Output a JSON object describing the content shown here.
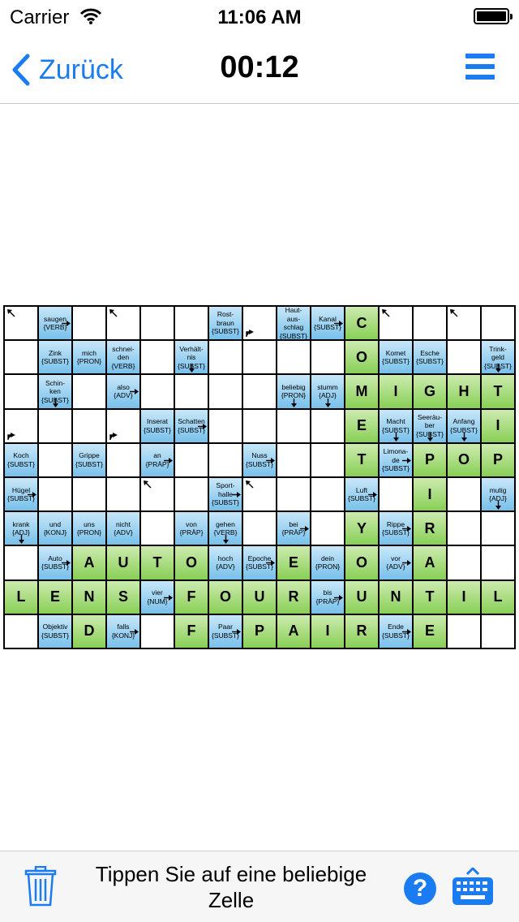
{
  "status_bar": {
    "carrier": "Carrier",
    "time": "11:06 AM"
  },
  "nav": {
    "back_label": "Zurück",
    "timer": "00:12"
  },
  "toolbar": {
    "hint": "Tippen Sie auf eine beliebige Zelle"
  },
  "colors": {
    "accent": "#1a7cf0",
    "clue_cell": "#8dcdf0",
    "solution_cell": "#9ad96a"
  },
  "grid": {
    "rows": [
      [
        {
          "t": "e",
          "ar": "ul"
        },
        {
          "t": "c",
          "l": [
            "saugen",
            "{VERB}"
          ],
          "ar": "r"
        },
        {
          "t": "e"
        },
        {
          "t": "e",
          "ar": "ul"
        },
        {
          "t": "e"
        },
        {
          "t": "e"
        },
        {
          "t": "c",
          "l": [
            "Rost-",
            "braun",
            "{SUBST}"
          ]
        },
        {
          "t": "e",
          "ar": "ur"
        },
        {
          "t": "c",
          "l": [
            "Haut-",
            "aus-",
            "schlag",
            "{SUBST}"
          ]
        },
        {
          "t": "c",
          "l": [
            "Kanal",
            "{SUBST}"
          ],
          "ar": "r"
        },
        {
          "t": "s",
          "v": "C"
        },
        {
          "t": "e",
          "ar": "ul"
        },
        {
          "t": "e"
        },
        {
          "t": "e",
          "ar": "ul"
        },
        {
          "t": "e"
        }
      ],
      [
        {
          "t": "e"
        },
        {
          "t": "c",
          "l": [
            "Zink",
            "{SUBST}"
          ]
        },
        {
          "t": "c",
          "l": [
            "mich",
            "{PRON}"
          ]
        },
        {
          "t": "c",
          "l": [
            "schnei-",
            "den",
            "{VERB}"
          ]
        },
        {
          "t": "e"
        },
        {
          "t": "c",
          "l": [
            "Verhält-",
            "nis",
            "{SUBST}"
          ],
          "ar": "d"
        },
        {
          "t": "e"
        },
        {
          "t": "e"
        },
        {
          "t": "e"
        },
        {
          "t": "e"
        },
        {
          "t": "s",
          "v": "O"
        },
        {
          "t": "c",
          "l": [
            "Komet",
            "{SUBST}"
          ]
        },
        {
          "t": "c",
          "l": [
            "Esche",
            "{SUBST}"
          ]
        },
        {
          "t": "e"
        },
        {
          "t": "c",
          "l": [
            "Trink-",
            "geld",
            "{SUBST}"
          ],
          "ar": "d"
        }
      ],
      [
        {
          "t": "e"
        },
        {
          "t": "c",
          "l": [
            "Schin-",
            "ken",
            "{SUBST}"
          ],
          "ar": "d"
        },
        {
          "t": "e"
        },
        {
          "t": "c",
          "l": [
            "also",
            "{ADV}"
          ],
          "ar": "r"
        },
        {
          "t": "e"
        },
        {
          "t": "e"
        },
        {
          "t": "e"
        },
        {
          "t": "e"
        },
        {
          "t": "c",
          "l": [
            "beliebig",
            "{PRON}"
          ],
          "ar": "d"
        },
        {
          "t": "c",
          "l": [
            "stumm",
            "{ADJ}"
          ],
          "ar": "d"
        },
        {
          "t": "s",
          "v": "M"
        },
        {
          "t": "s",
          "v": "I"
        },
        {
          "t": "s",
          "v": "G"
        },
        {
          "t": "s",
          "v": "H"
        },
        {
          "t": "s",
          "v": "T"
        }
      ],
      [
        {
          "t": "e",
          "ar": "ur"
        },
        {
          "t": "e"
        },
        {
          "t": "e"
        },
        {
          "t": "e",
          "ar": "ur"
        },
        {
          "t": "c",
          "l": [
            "Inserat",
            "{SUBST}"
          ]
        },
        {
          "t": "c",
          "l": [
            "Schatten",
            "{SUBST}"
          ],
          "ar": "r"
        },
        {
          "t": "e"
        },
        {
          "t": "e"
        },
        {
          "t": "e"
        },
        {
          "t": "e"
        },
        {
          "t": "s",
          "v": "E"
        },
        {
          "t": "c",
          "l": [
            "Macht",
            "{SUBST}"
          ],
          "ar": "d"
        },
        {
          "t": "c",
          "l": [
            "Seeräu-",
            "ber",
            "{SUBST}"
          ],
          "ar": "d"
        },
        {
          "t": "c",
          "l": [
            "Anfang",
            "{SUBST}"
          ],
          "ar": "d"
        },
        {
          "t": "s",
          "v": "I"
        }
      ],
      [
        {
          "t": "c",
          "l": [
            "Koch",
            "{SUBST}"
          ]
        },
        {
          "t": "e"
        },
        {
          "t": "c",
          "l": [
            "Grippe",
            "{SUBST}"
          ]
        },
        {
          "t": "e"
        },
        {
          "t": "c",
          "l": [
            "an",
            "{PRÄP}"
          ],
          "ar": "r"
        },
        {
          "t": "e"
        },
        {
          "t": "e"
        },
        {
          "t": "c",
          "l": [
            "Nuss",
            "{SUBST}"
          ],
          "ar": "r"
        },
        {
          "t": "e"
        },
        {
          "t": "e"
        },
        {
          "t": "s",
          "v": "T"
        },
        {
          "t": "c",
          "l": [
            "Limona-",
            "de",
            "{SUBST}"
          ],
          "ar": "r"
        },
        {
          "t": "s",
          "v": "P"
        },
        {
          "t": "s",
          "v": "O"
        },
        {
          "t": "s",
          "v": "P"
        }
      ],
      [
        {
          "t": "c",
          "l": [
            "Hügel",
            "{SUBST}"
          ],
          "ar": "r"
        },
        {
          "t": "e"
        },
        {
          "t": "e"
        },
        {
          "t": "e"
        },
        {
          "t": "e",
          "ar": "ul"
        },
        {
          "t": "e"
        },
        {
          "t": "c",
          "l": [
            "Sport-",
            "halle",
            "{SUBST}"
          ],
          "ar": "r"
        },
        {
          "t": "e",
          "ar": "ul"
        },
        {
          "t": "e"
        },
        {
          "t": "e"
        },
        {
          "t": "c",
          "l": [
            "Luft",
            "{SUBST}"
          ],
          "ar": "r"
        },
        {
          "t": "e"
        },
        {
          "t": "s",
          "v": "I"
        },
        {
          "t": "e"
        },
        {
          "t": "c",
          "l": [
            "mutig",
            "{ADJ}"
          ],
          "ar": "d"
        }
      ],
      [
        {
          "t": "c",
          "l": [
            "krank",
            "{ADJ}"
          ],
          "ar": "d"
        },
        {
          "t": "c",
          "l": [
            "und",
            "{KONJ}"
          ]
        },
        {
          "t": "c",
          "l": [
            "uns",
            "{PRON}"
          ]
        },
        {
          "t": "c",
          "l": [
            "nicht",
            "{ADV}"
          ]
        },
        {
          "t": "e"
        },
        {
          "t": "c",
          "l": [
            "von",
            "{PRÄP}"
          ]
        },
        {
          "t": "c",
          "l": [
            "gehen",
            "{VERB}"
          ],
          "ar": "d"
        },
        {
          "t": "e"
        },
        {
          "t": "c",
          "l": [
            "bei",
            "{PRÄP}"
          ],
          "ar": "r"
        },
        {
          "t": "e"
        },
        {
          "t": "s",
          "v": "Y"
        },
        {
          "t": "c",
          "l": [
            "Rippe",
            "{SUBST}"
          ],
          "ar": "r"
        },
        {
          "t": "s",
          "v": "R"
        },
        {
          "t": "e"
        },
        {
          "t": "e"
        }
      ],
      [
        {
          "t": "e"
        },
        {
          "t": "c",
          "l": [
            "Auto",
            "{SUBST}"
          ],
          "ar": "r"
        },
        {
          "t": "s",
          "v": "A"
        },
        {
          "t": "s",
          "v": "U"
        },
        {
          "t": "s",
          "v": "T"
        },
        {
          "t": "s",
          "v": "O"
        },
        {
          "t": "c",
          "l": [
            "hoch",
            "{ADV}"
          ]
        },
        {
          "t": "c",
          "l": [
            "Epoche",
            "{SUBST}"
          ],
          "ar": "r"
        },
        {
          "t": "s",
          "v": "E"
        },
        {
          "t": "c",
          "l": [
            "dein",
            "{PRON}"
          ]
        },
        {
          "t": "s",
          "v": "O"
        },
        {
          "t": "c",
          "l": [
            "vor",
            "{ADV}"
          ],
          "ar": "r"
        },
        {
          "t": "s",
          "v": "A"
        },
        {
          "t": "e"
        },
        {
          "t": "e"
        }
      ],
      [
        {
          "t": "s",
          "v": "L"
        },
        {
          "t": "s",
          "v": "E"
        },
        {
          "t": "s",
          "v": "N"
        },
        {
          "t": "s",
          "v": "S"
        },
        {
          "t": "c",
          "l": [
            "vier",
            "{NUM}"
          ],
          "ar": "r"
        },
        {
          "t": "s",
          "v": "F"
        },
        {
          "t": "s",
          "v": "O"
        },
        {
          "t": "s",
          "v": "U"
        },
        {
          "t": "s",
          "v": "R"
        },
        {
          "t": "c",
          "l": [
            "bis",
            "{PRÄP}"
          ],
          "ar": "r"
        },
        {
          "t": "s",
          "v": "U"
        },
        {
          "t": "s",
          "v": "N"
        },
        {
          "t": "s",
          "v": "T"
        },
        {
          "t": "s",
          "v": "I"
        },
        {
          "t": "s",
          "v": "L"
        }
      ],
      [
        {
          "t": "e"
        },
        {
          "t": "c",
          "l": [
            "Objektiv",
            "{SUBST}"
          ]
        },
        {
          "t": "s",
          "v": "D"
        },
        {
          "t": "c",
          "l": [
            "falls",
            "{KONJ}"
          ],
          "ar": "r"
        },
        {
          "t": "e"
        },
        {
          "t": "s",
          "v": "F"
        },
        {
          "t": "c",
          "l": [
            "Paar",
            "{SUBST}"
          ],
          "ar": "r"
        },
        {
          "t": "s",
          "v": "P"
        },
        {
          "t": "s",
          "v": "A"
        },
        {
          "t": "s",
          "v": "I"
        },
        {
          "t": "s",
          "v": "R"
        },
        {
          "t": "c",
          "l": [
            "Ende",
            "{SUBST}"
          ],
          "ar": "r"
        },
        {
          "t": "s",
          "v": "E"
        },
        {
          "t": "e"
        },
        {
          "t": "e"
        }
      ]
    ]
  }
}
